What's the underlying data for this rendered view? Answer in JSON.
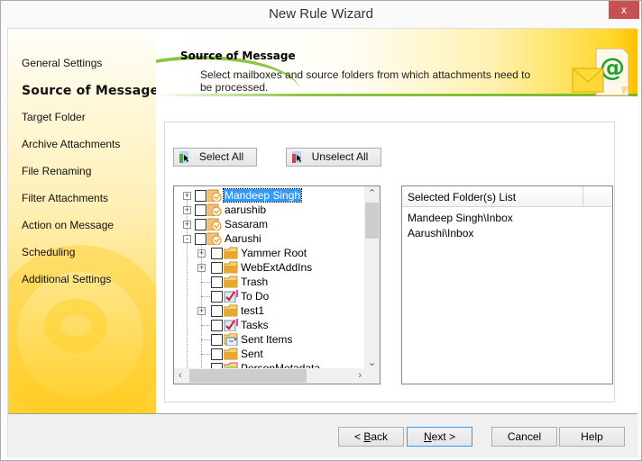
{
  "window": {
    "title": "New Rule Wizard",
    "close_label": "x"
  },
  "sidebar": {
    "items": [
      {
        "label": "General Settings",
        "active": false
      },
      {
        "label": "Source of Message",
        "active": true
      },
      {
        "label": "Target Folder",
        "active": false
      },
      {
        "label": "Archive Attachments",
        "active": false
      },
      {
        "label": "File Renaming",
        "active": false
      },
      {
        "label": "Filter Attachments",
        "active": false
      },
      {
        "label": "Action on Message",
        "active": false
      },
      {
        "label": "Scheduling",
        "active": false
      },
      {
        "label": "Additional Settings",
        "active": false
      }
    ]
  },
  "header": {
    "title": "Source of Message",
    "description": "Select mailboxes and source folders from which attachments need to be processed.",
    "icon": "mail-at-icon"
  },
  "toolbar": {
    "select_all": "Select All",
    "unselect_all": "Unselect All"
  },
  "tree": {
    "items": [
      {
        "label": "Mandeep Singh",
        "level": 0,
        "expander": "+",
        "icon": "mailbox-icon",
        "selected": true
      },
      {
        "label": "aarushib",
        "level": 0,
        "expander": "+",
        "icon": "mailbox-icon"
      },
      {
        "label": "Sasaram",
        "level": 0,
        "expander": "+",
        "icon": "mailbox-icon"
      },
      {
        "label": "Aarushi",
        "level": 0,
        "expander": "-",
        "icon": "mailbox-icon"
      },
      {
        "label": "Yammer Root",
        "level": 1,
        "expander": "+",
        "icon": "folder-icon"
      },
      {
        "label": "WebExtAddIns",
        "level": 1,
        "expander": "+",
        "icon": "folder-icon"
      },
      {
        "label": "Trash",
        "level": 1,
        "expander": "",
        "icon": "folder-icon"
      },
      {
        "label": "To Do",
        "level": 1,
        "expander": "",
        "icon": "task-icon"
      },
      {
        "label": "test1",
        "level": 1,
        "expander": "+",
        "icon": "folder-icon"
      },
      {
        "label": "Tasks",
        "level": 1,
        "expander": "",
        "icon": "task-icon"
      },
      {
        "label": "Sent Items",
        "level": 1,
        "expander": "",
        "icon": "sent-items-icon"
      },
      {
        "label": "Sent",
        "level": 1,
        "expander": "",
        "icon": "folder-icon"
      },
      {
        "label": "PersonMetadata",
        "level": 1,
        "expander": "",
        "icon": "contacts-folder-icon"
      }
    ]
  },
  "selected_list": {
    "header": "Selected Folder(s) List",
    "items": [
      "Mandeep Singh\\Inbox",
      "Aarushi\\Inbox"
    ]
  },
  "footer": {
    "back": {
      "prefix": "< ",
      "mnemonic": "B",
      "rest": "ack"
    },
    "next": {
      "mnemonic": "N",
      "rest": "ext >"
    },
    "cancel": "Cancel",
    "help": "Help"
  }
}
